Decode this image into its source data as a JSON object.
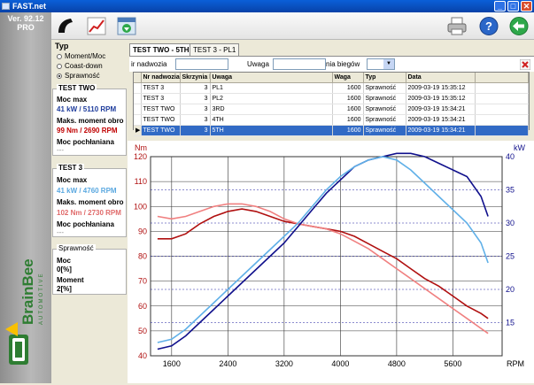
{
  "window": {
    "title": "FAST.net",
    "minimize": "_",
    "maximize": "□",
    "close": "✕"
  },
  "sidebar": {
    "version": "Ver. 92.12",
    "edition": "PRO",
    "brand": "BrainBee",
    "brand_sub": "AUTOMOTIVE"
  },
  "toolbar": {
    "icons": [
      "car-icon",
      "chart-icon",
      "export-icon",
      "printer-icon",
      "help-icon",
      "back-icon"
    ]
  },
  "typ": {
    "title": "Typ",
    "options": [
      {
        "label": "Moment/Moc",
        "selected": false
      },
      {
        "label": "Coast-down",
        "selected": false
      },
      {
        "label": "Sprawność",
        "selected": true
      }
    ]
  },
  "test_two": {
    "title": "TEST TWO",
    "moc_label": "Moc max",
    "moc_value": "41 kW / 5110 RPM",
    "moment_label": "Maks. moment obro",
    "moment_value": "99 Nm / 2690 RPM",
    "pochl_label": "Moc pochłaniana",
    "pochl_value": "---"
  },
  "test_3": {
    "title": "TEST 3",
    "moc_label": "Moc max",
    "moc_value": "41 kW / 4760 RPM",
    "moment_label": "Maks. moment obro",
    "moment_value": "102 Nm / 2730 RPM",
    "pochl_label": "Moc pochłaniana",
    "pochl_value": "---"
  },
  "sprawnosc": {
    "title": "Sprawność",
    "moc_label": "Moc",
    "moc_value": "0[%]",
    "moment_label": "Moment",
    "moment_value": "2[%]"
  },
  "tabs": [
    {
      "label": "TEST TWO - 5TH",
      "active": true
    },
    {
      "label": "TEST 3 - PL1",
      "active": false
    }
  ],
  "filters": {
    "nr_label": "ir nadwozia",
    "uwaga_label": "Uwaga",
    "biegow_label": "nia biegów",
    "nr_value": "",
    "uwaga_value": "",
    "biegow_value": ""
  },
  "table": {
    "columns": [
      "Nr nadwozia",
      "Skrzynia b",
      "Uwaga",
      "Waga",
      "Typ",
      "Data"
    ],
    "rows": [
      [
        "TEST 3",
        "3",
        "PL1",
        "1600",
        "Sprawność",
        "2009-03-19 15:35:12"
      ],
      [
        "TEST 3",
        "3",
        "PL2",
        "1600",
        "Sprawność",
        "2009-03-19 15:35:12"
      ],
      [
        "TEST TWO",
        "3",
        "3RD",
        "1600",
        "Sprawność",
        "2009-03-19 15:34:21"
      ],
      [
        "TEST TWO",
        "3",
        "4TH",
        "1600",
        "Sprawność",
        "2009-03-19 15:34:21"
      ],
      [
        "TEST TWO",
        "3",
        "5TH",
        "1600",
        "Sprawność",
        "2009-03-19 15:34:21"
      ]
    ],
    "selected_row": 4,
    "row_marker": "▶"
  },
  "colors": {
    "title_blue": "#0a5fd8",
    "selection": "#316ac5",
    "torque_dark": "#b01010",
    "torque_light": "#f08080",
    "power_dark": "#10108c",
    "power_light": "#60b0e8",
    "test_two_text": "#1e3c9c",
    "test_two_torque_text": "#c00000",
    "test_3_text": "#5aa8e0",
    "test_3_torque_text": "#e06a6a"
  },
  "chart_data": {
    "type": "line",
    "xlabel": "RPM",
    "ylabel_left": "Nm",
    "ylabel_right": "kW",
    "xlim": [
      1300,
      6300
    ],
    "x_ticks": [
      1600,
      2400,
      3200,
      4000,
      4800,
      5600
    ],
    "y_left_lim": [
      40,
      120
    ],
    "y_left_ticks": [
      40,
      50,
      60,
      70,
      80,
      90,
      100,
      110,
      120
    ],
    "y_right_lim": [
      10,
      40
    ],
    "y_right_ticks": [
      15,
      20,
      25,
      30,
      35,
      40
    ],
    "grid": true,
    "series": [
      {
        "axis": "left",
        "color": "#b01010",
        "x": [
          1400,
          1600,
          1800,
          2000,
          2200,
          2400,
          2600,
          2800,
          3000,
          3200,
          3400,
          3600,
          3800,
          4000,
          4200,
          4400,
          4600,
          4800,
          5000,
          5200,
          5400,
          5600,
          5800,
          6000,
          6100
        ],
        "y": [
          87,
          87,
          89,
          93,
          96,
          98,
          99,
          98,
          96,
          94,
          93,
          92,
          91,
          90,
          88,
          85,
          82,
          79,
          75,
          71,
          68,
          64,
          60,
          57,
          55
        ]
      },
      {
        "axis": "left",
        "color": "#f08080",
        "x": [
          1400,
          1600,
          1800,
          2000,
          2200,
          2400,
          2600,
          2800,
          3000,
          3200,
          3400,
          3600,
          3800,
          4000,
          4200,
          4400,
          4600,
          4800,
          5000,
          5200,
          5400,
          5600,
          5800,
          6000,
          6100
        ],
        "y": [
          96,
          95,
          96,
          98,
          100,
          101,
          101,
          100,
          98,
          95,
          93,
          92,
          91,
          89,
          86,
          83,
          79,
          75,
          71,
          67,
          63,
          59,
          55,
          51,
          49
        ]
      },
      {
        "axis": "right",
        "color": "#10108c",
        "x": [
          1400,
          1600,
          1800,
          2000,
          2200,
          2400,
          2600,
          2800,
          3000,
          3200,
          3400,
          3600,
          3800,
          4000,
          4200,
          4400,
          4600,
          4800,
          5000,
          5200,
          5400,
          5600,
          5800,
          6000,
          6100
        ],
        "y": [
          11,
          11.5,
          13,
          15,
          17,
          19,
          21,
          23,
          25,
          27,
          29.5,
          32,
          34.5,
          36.5,
          38.5,
          39.5,
          40,
          40.5,
          40.5,
          40,
          39,
          38,
          37,
          34,
          31
        ]
      },
      {
        "axis": "right",
        "color": "#60b0e8",
        "x": [
          1400,
          1600,
          1800,
          2000,
          2200,
          2400,
          2600,
          2800,
          3000,
          3200,
          3400,
          3600,
          3800,
          4000,
          4200,
          4400,
          4600,
          4800,
          5000,
          5200,
          5400,
          5600,
          5800,
          6000,
          6100
        ],
        "y": [
          12,
          12.5,
          14,
          16,
          18,
          20,
          22,
          24,
          26,
          28,
          30,
          32.5,
          35,
          37,
          38.5,
          39.5,
          40,
          39.5,
          38,
          36,
          34,
          32,
          30,
          27,
          24
        ]
      }
    ]
  }
}
